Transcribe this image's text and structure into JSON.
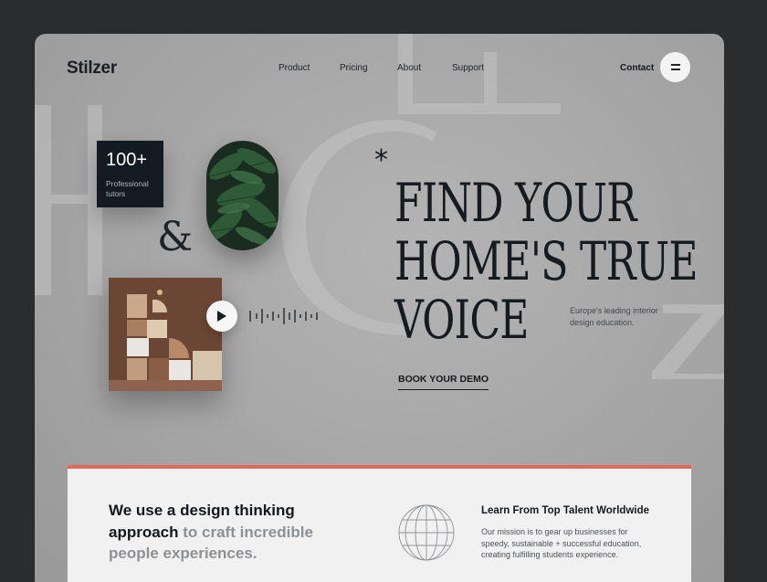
{
  "brand": {
    "name": "Stilzer"
  },
  "nav": {
    "items": [
      {
        "label": "Product"
      },
      {
        "label": "Pricing"
      },
      {
        "label": "About"
      },
      {
        "label": "Support"
      }
    ],
    "contact": "Contact",
    "menu_icon": "hamburger-icon"
  },
  "stat": {
    "value": "100+",
    "label": "Professional tutors"
  },
  "ampersand": "&",
  "hero": {
    "asterisk": "*",
    "headline_lines": [
      "FIND YOUR",
      "HOME'S TRUE",
      "VOICE"
    ],
    "tagline": "Europe's leading interior design education.",
    "cta": "BOOK YOUR DEMO"
  },
  "media": {
    "play_icon": "play-icon",
    "waveform_icon": "audio-waveform-icon",
    "leaf_image": "monstera leaves photo",
    "decor_image": "geometric blocks sculpture photo"
  },
  "about": {
    "heading_strong": "We use a design thinking approach",
    "heading_muted": " to craft incredible people experiences.",
    "globe_icon": "globe-icon",
    "feature_title": "Learn From Top Talent Worldwide",
    "feature_desc": "Our mission is to gear up businesses for speedy, sustainable + successful education, creating fulfilling students experience."
  },
  "colors": {
    "accent": "#e2685a",
    "dark": "#131b22",
    "background": "#2b2c2e",
    "panel": "#f1f1f1"
  }
}
